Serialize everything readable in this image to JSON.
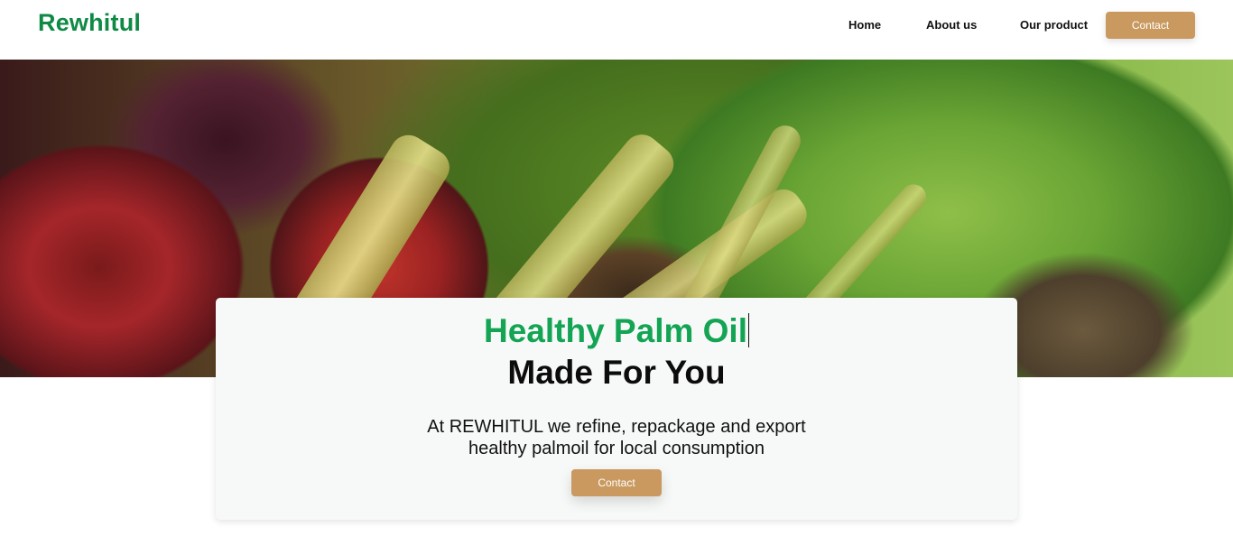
{
  "header": {
    "logo": "Rewhitul",
    "nav": {
      "home": "Home",
      "about": "About us",
      "product": "Our product",
      "contact": "Contact"
    }
  },
  "hero": {
    "title_line1": "Healthy Palm Oil",
    "title_line2": "Made For You",
    "description_line1": "At REWHITUL we refine, repackage and export",
    "description_line2": "healthy palmoil for local consumption",
    "cta": "Contact"
  },
  "colors": {
    "brand_green": "#13a454",
    "logo_green": "#0f8a45",
    "button_tan": "#c9995f"
  }
}
